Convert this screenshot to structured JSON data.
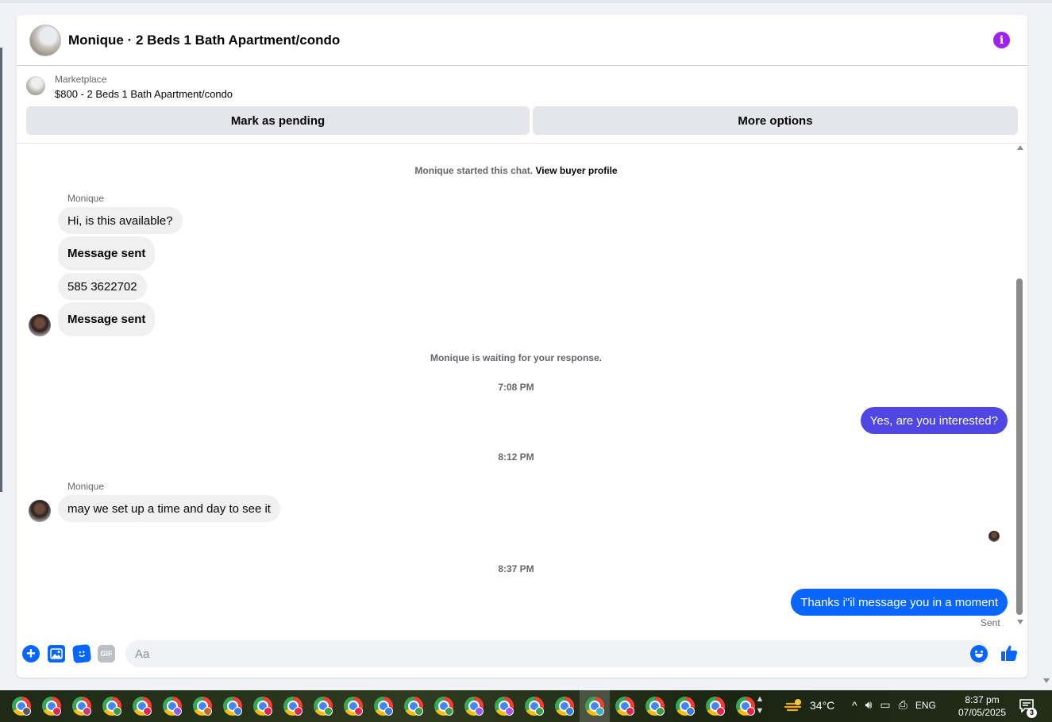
{
  "header": {
    "title": "Monique · 2 Beds 1 Bath Apartment/condo"
  },
  "listing": {
    "category": "Marketplace",
    "price_title": "$800 - 2 Beds 1 Bath Apartment/condo",
    "mark_pending_label": "Mark as pending",
    "more_options_label": "More options"
  },
  "chat": {
    "started_text": "Monique started this chat.",
    "view_profile_link": "View buyer profile",
    "waiting_text": "Monique is waiting for your response.",
    "messages": [
      {
        "sender": "Monique",
        "text": "Hi, is this available?"
      },
      {
        "text": "Message sent"
      },
      {
        "text": "585 3622702"
      },
      {
        "text": "Message sent"
      },
      {
        "time": "7:08 PM"
      },
      {
        "text": "Yes, are you interested?"
      },
      {
        "time": "8:12 PM"
      },
      {
        "sender": "Monique",
        "text": "may we set up a time and day to see it"
      },
      {
        "time": "8:37 PM"
      },
      {
        "text": "Thanks i\"il message you in a moment"
      }
    ],
    "sent_status": "Sent"
  },
  "composer": {
    "placeholder": "Aa",
    "gif_label": "GIF"
  },
  "taskbar": {
    "temperature": "34°C",
    "language": "ENG",
    "time": "8:37 pm",
    "date": "07/05/2025",
    "notification_count": "3",
    "app_badge_colors": [
      "#5a5a5a",
      "#e2244f",
      "#d43a6b",
      "#3b9b4a",
      "#e2244f",
      "#8b5cf6",
      "#c26a2a",
      "#3c7bd6",
      "#e2244f",
      "#e2244f",
      "#3b9b4a",
      "#e2244f",
      "#3c7bd6",
      "#3b9b4a",
      "#3b9b4a",
      "#8b5cf6",
      "#a855f7",
      "#3b9b4a",
      "#3c7bd6",
      "#3ab0c4",
      "#e2244f",
      "#3b9b4a",
      "#3c7bd6",
      "#e2244f",
      "#e2244f"
    ]
  },
  "colors": {
    "accent_blue": "#0866ff",
    "accent_purple": "#4f46e5",
    "info_icon": "#a020f0"
  }
}
